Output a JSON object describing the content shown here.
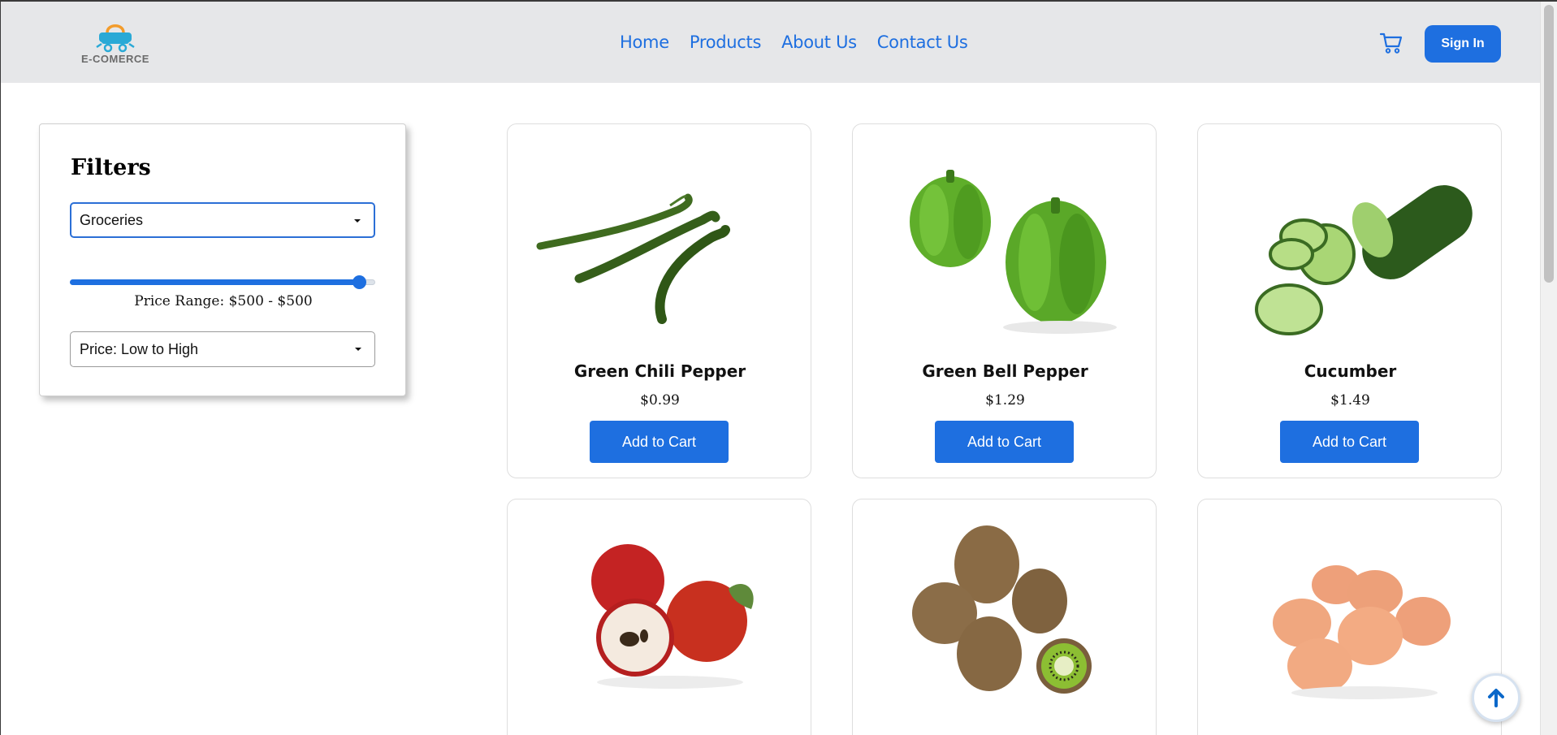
{
  "header": {
    "logo_text": "E-COMERCE",
    "nav": [
      "Home",
      "Products",
      "About Us",
      "Contact Us"
    ],
    "sign_in_label": "Sign In"
  },
  "colors": {
    "accent": "#1e6fe0",
    "header_bg": "#e6e7e9"
  },
  "filters": {
    "title": "Filters",
    "category_value": "Groceries",
    "price_slider": {
      "min": 0,
      "max": 500,
      "value": 500,
      "fraction": 0.97
    },
    "price_range_text": "Price Range: $500 - $500",
    "sort_value": "Price: Low to High"
  },
  "products": [
    {
      "name": "Green Chili Pepper",
      "price": "$0.99",
      "button": "Add to Cart",
      "image": "green-chili-pepper-image"
    },
    {
      "name": "Green Bell Pepper",
      "price": "$1.29",
      "button": "Add to Cart",
      "image": "green-bell-pepper-image"
    },
    {
      "name": "Cucumber",
      "price": "$1.49",
      "button": "Add to Cart",
      "image": "cucumber-image"
    },
    {
      "name": "",
      "price": "",
      "button": "",
      "image": "apple-image"
    },
    {
      "name": "",
      "price": "",
      "button": "",
      "image": "kiwi-image"
    },
    {
      "name": "",
      "price": "",
      "button": "",
      "image": "eggs-image"
    }
  ],
  "icons": {
    "cart": "cart-icon",
    "scroll_top": "arrow-up-icon"
  }
}
